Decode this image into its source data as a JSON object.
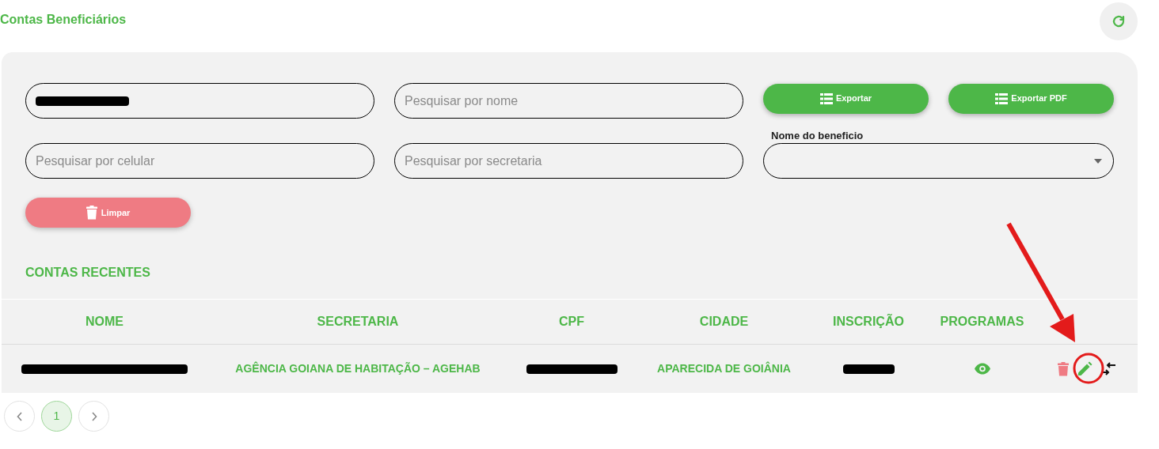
{
  "title": "Contas Beneficiários",
  "filters": {
    "cpf": {
      "redacted": true
    },
    "nome": {
      "placeholder": "Pesquisar por nome"
    },
    "celular": {
      "placeholder": "Pesquisar por celular"
    },
    "secretaria": {
      "placeholder": "Pesquisar por secretaria"
    },
    "beneficio": {
      "label": "Nome do beneficio"
    }
  },
  "buttons": {
    "exportar": "Exportar",
    "exportar_pdf": "Exportar PDF",
    "limpar": "Limpar"
  },
  "section_title": "CONTAS RECENTES",
  "table": {
    "columns": [
      "NOME",
      "SECRETARIA",
      "CPF",
      "CIDADE",
      "INSCRIÇÃO",
      "PROGRAMAS"
    ],
    "rows": [
      {
        "cells": [
          {
            "redacted": true
          },
          {
            "text": "AGÊNCIA GOIANA DE HABITAÇÃO – AGEHAB"
          },
          {
            "redacted": true
          },
          {
            "text": "APARECIDA DE GOIÂNIA"
          },
          {
            "redacted": true
          }
        ]
      }
    ]
  },
  "pagination": {
    "pages": [
      {
        "label": "1",
        "selected": true
      }
    ]
  }
}
